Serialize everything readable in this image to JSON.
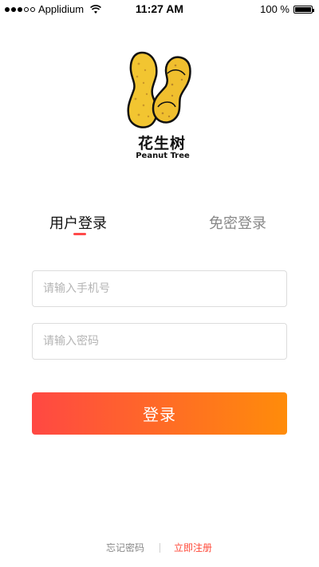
{
  "status_bar": {
    "carrier": "Applidium",
    "time": "11:27 AM",
    "battery_percent": "100 %"
  },
  "logo": {
    "name_cn": "花生树",
    "name_en": "Peanut Tree"
  },
  "tabs": [
    {
      "label": "用户登录",
      "active": true
    },
    {
      "label": "免密登录",
      "active": false
    }
  ],
  "form": {
    "phone_placeholder": "请输入手机号",
    "password_placeholder": "请输入密码",
    "phone_value": "",
    "password_value": "",
    "login_label": "登录"
  },
  "footer": {
    "forgot_label": "忘记密码",
    "register_label": "立即注册"
  },
  "colors": {
    "accent": "#ff4a4a",
    "gradient_start": "#ff4843",
    "gradient_end": "#ff8c0a",
    "register_link": "#ff4a3a"
  },
  "icons": [
    "signal-icon",
    "wifi-icon",
    "battery-icon",
    "peanut-logo-icon"
  ]
}
